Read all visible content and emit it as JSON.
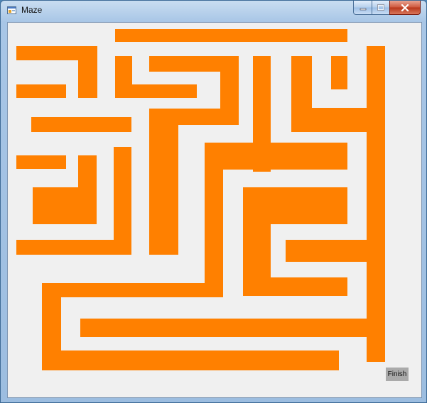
{
  "window": {
    "title": "Maze",
    "app_icon": "form-window-icon",
    "controls": [
      "minimize-icon",
      "maximize-icon",
      "close-icon"
    ]
  },
  "maze": {
    "wall_color": "#ff8000",
    "background_color": "#f0f0f0"
  },
  "finish": {
    "label": "Finish",
    "color": "#aaaaaa"
  }
}
